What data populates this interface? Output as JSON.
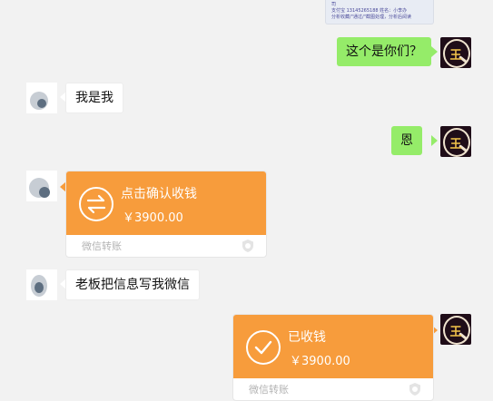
{
  "top_card": {
    "lines": [
      "司",
      "支付宝 13145265188  姓名：小李办",
      "分析收藏/\"通过/\"截图处理，分析后阅读"
    ]
  },
  "messages": [
    {
      "side": "right",
      "type": "text",
      "text": "这个是你们？"
    },
    {
      "side": "left",
      "type": "text",
      "text": "我是我"
    },
    {
      "side": "right",
      "type": "text",
      "text": "恩"
    },
    {
      "side": "left",
      "type": "transfer",
      "title": "点击确认收钱",
      "amount": "￥3900.00",
      "footer": "微信转账",
      "icon": "transfer-arrows-icon"
    },
    {
      "side": "left",
      "type": "text",
      "text": "老板把信息写我微信"
    },
    {
      "side": "right",
      "type": "transfer",
      "title": "已收钱",
      "amount": "￥3900.00",
      "footer": "微信转账",
      "icon": "checkmark-icon"
    }
  ],
  "avatar_mark": "王",
  "colors": {
    "background": "#f2f2f2",
    "sent_bubble": "#95ec69",
    "received_bubble": "#ffffff",
    "transfer_orange": "#f79c3c",
    "footer_text": "#b3b3b3"
  }
}
